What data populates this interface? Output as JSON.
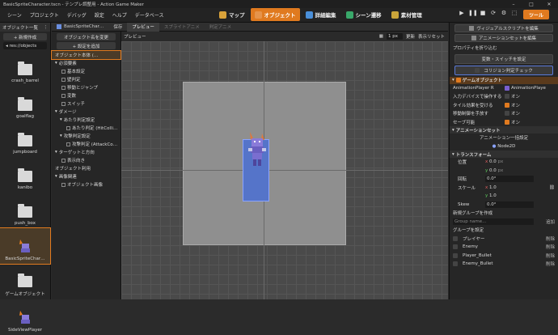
{
  "window": {
    "title": "BasicSpriteCharacter.tscn - テンプレ調整用 - Action Game Maker"
  },
  "menu": [
    "シーン",
    "プロジェクト",
    "デバッグ",
    "設定",
    "ヘルプ",
    "データベース"
  ],
  "tabs": [
    {
      "label": "マップ",
      "color": "#d9a23a"
    },
    {
      "label": "オブジェクト",
      "color": "#e07a1f"
    },
    {
      "label": "詳細編集",
      "color": "#4a8fd9"
    },
    {
      "label": "シーン遷移",
      "color": "#39a86a"
    },
    {
      "label": "素材管理",
      "color": "#c9a43a"
    }
  ],
  "run": [
    "▶",
    "❚❚",
    "■",
    "⟳",
    "⚙",
    "⬚"
  ],
  "tools_button": "ツール",
  "left": {
    "header": "オブジェクト一覧",
    "new_button": "+ 新規作成",
    "path": "res://objects",
    "items": [
      {
        "label": "crash_barrel",
        "kind": "folder"
      },
      {
        "label": "goalflag",
        "kind": "folder"
      },
      {
        "label": "jumpboard",
        "kind": "folder"
      },
      {
        "label": "kanibo",
        "kind": "folder"
      },
      {
        "label": "push_box",
        "kind": "folder"
      },
      {
        "label": "BasicSpriteChar…",
        "kind": "sprite"
      },
      {
        "label": "ゲームオブジェクト",
        "kind": "folder"
      },
      {
        "label": "SideViewPlayer",
        "kind": "sprite"
      }
    ]
  },
  "objtab": {
    "name": "BasicSpriteChar…",
    "save": "保存",
    "preview": "プレビュー",
    "sprite_anim": "スプライトアニメ",
    "judge_anim": "判定アニメ"
  },
  "panel2": {
    "rename": "オブジェクト名を変更",
    "add_setting": "+ 設定を追加",
    "rows": [
      {
        "label": "オブジェクト本体 (…",
        "indent": 4,
        "sel": true
      },
      {
        "label": "必須要素",
        "indent": 4,
        "caret": true
      },
      {
        "label": "基本設定",
        "indent": 12,
        "cb": true
      },
      {
        "label": "壁判定",
        "indent": 12,
        "cb": true
      },
      {
        "label": "移動とジャンプ",
        "indent": 12,
        "cb": true
      },
      {
        "label": "変数",
        "indent": 12,
        "cb": true
      },
      {
        "label": "スイッチ",
        "indent": 12,
        "cb": true
      },
      {
        "label": "ダメージ",
        "indent": 4,
        "caret": true
      },
      {
        "label": "あたり判定設定",
        "indent": 10,
        "caret": true
      },
      {
        "label": "あたり判定 (HitColli…",
        "indent": 18,
        "cb": true
      },
      {
        "label": "攻撃判定設定",
        "indent": 10,
        "caret": true
      },
      {
        "label": "攻撃判定 (AttackCo…",
        "indent": 18,
        "cb": true
      },
      {
        "label": "ターゲットと方向",
        "indent": 4,
        "caret": true
      },
      {
        "label": "表示向き",
        "indent": 12,
        "cb": true
      },
      {
        "label": "オブジェクト利用",
        "indent": 4
      },
      {
        "label": "画像関連",
        "indent": 4,
        "caret": true
      },
      {
        "label": "オブジェクト画像",
        "indent": 12,
        "cb": true
      }
    ]
  },
  "preview_bar": {
    "label": "プレビュー",
    "size": "1 px",
    "update": "更新",
    "reset": "表示リセット"
  },
  "right": {
    "visual_script": "ヴィジュアルスクリプトを編集",
    "anim_set": "アニメーションセットを編集",
    "prop_collapse": "プロパティを折り込む",
    "var_switch": "変数・スイッチを設定",
    "collision_check": "コリジョン判定チェック",
    "sec_gameobject": "ゲームオブジェクト",
    "rows1": [
      {
        "label": "AnimationPlayer R",
        "value": "AnimationPlaye"
      },
      {
        "label": "入力デバイスで操作する",
        "value": "オン",
        "on": false
      },
      {
        "label": "タイル効果を受ける",
        "value": "オン",
        "on": true
      },
      {
        "label": "移動制御を手放す",
        "value": "オン",
        "on": false
      },
      {
        "label": "セーブ可能",
        "value": "オン",
        "on": true
      }
    ],
    "sec_animset": "アニメーションセット",
    "anim_sync": "アニメーション一括設定",
    "node2d": "Node2D",
    "sec_transform": "トランスフォーム",
    "pos_label": "位置",
    "pos_x": "0.0",
    "pos_y": "0.0",
    "px": "px",
    "rot_label": "回転",
    "rot": "0.0",
    "deg": "°",
    "scale_label": "スケール",
    "scale_x": "1.0",
    "scale_y": "1.0",
    "skew_label": "Skew",
    "skew": "0.0",
    "new_group": "新規グループを作成",
    "group_placeholder": "Group name...",
    "add": "追加",
    "group_settings": "グループを設定",
    "groups": [
      "プレイヤー",
      "Enemy",
      "Player_Bullet",
      "Enemy_Bullet"
    ],
    "delete": "削除"
  }
}
